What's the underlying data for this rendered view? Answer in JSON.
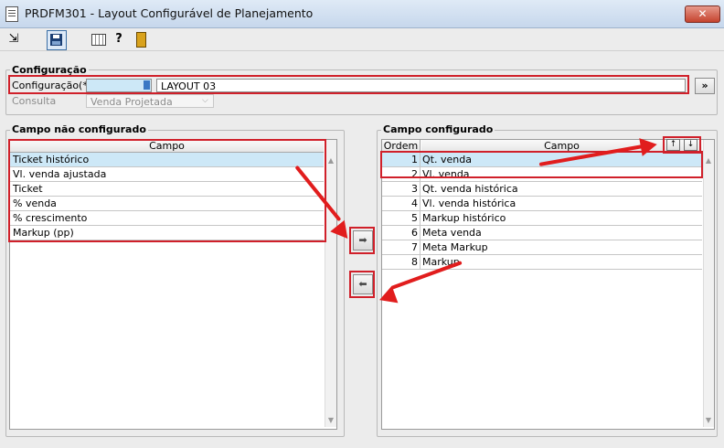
{
  "window": {
    "title": "PRDFM301 - Layout Configurável de Planejamento",
    "close_label": "✕"
  },
  "toolbar": {
    "icons": [
      "exit-icon",
      "save-icon",
      "grid-icon",
      "help-icon",
      "door-icon"
    ],
    "help_glyph": "?",
    "exit_glyph": "⇲"
  },
  "configuracao": {
    "legend": "Configuração",
    "config_label": "Configuração(*)",
    "config_code": "",
    "config_name": "LAYOUT 03",
    "consulta_label": "Consulta",
    "consulta_value": "Venda Projetada",
    "more_button": "»"
  },
  "left_panel": {
    "legend": "Campo não configurado",
    "column_header": "Campo",
    "rows": [
      "Ticket histórico",
      "Vl. venda ajustada",
      "Ticket",
      "% venda",
      "% crescimento",
      "Markup (pp)"
    ],
    "selected_index": 0
  },
  "right_panel": {
    "legend": "Campo configurado",
    "header_ordem": "Ordem",
    "header_campo": "Campo",
    "rows": [
      {
        "ordem": "1",
        "campo": "Qt. venda"
      },
      {
        "ordem": "2",
        "campo": "Vl. venda"
      },
      {
        "ordem": "3",
        "campo": "Qt. venda histórica"
      },
      {
        "ordem": "4",
        "campo": "Vl. venda histórica"
      },
      {
        "ordem": "5",
        "campo": "Markup histórico"
      },
      {
        "ordem": "6",
        "campo": "Meta venda"
      },
      {
        "ordem": "7",
        "campo": "Meta Markup"
      },
      {
        "ordem": "8",
        "campo": "Markup"
      }
    ],
    "selected_index": 0,
    "up_label": "↑",
    "down_label": "↓"
  },
  "move_buttons": {
    "add_label": "➡",
    "remove_label": "⬅"
  },
  "colors": {
    "annotation_red": "#d0202a",
    "selection_blue": "#cde8f7"
  }
}
